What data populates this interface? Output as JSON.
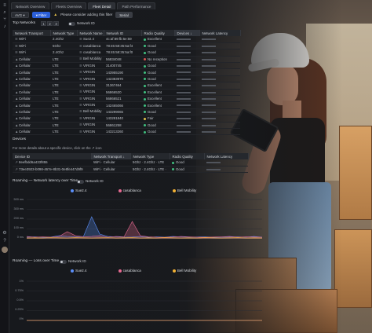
{
  "tabs": [
    {
      "label": "Network Overview",
      "active": false
    },
    {
      "label": "Fleets Overview",
      "active": false
    },
    {
      "label": "Fleet Detail",
      "active": true
    },
    {
      "label": "Path Performance",
      "active": false
    }
  ],
  "filterbar": {
    "avg_label": "AVG",
    "filter_label": "Filter",
    "warning_icon": "warning-triangle-icon",
    "warning_text": "Please consider adding this filter",
    "suggested_filter": "Serial"
  },
  "top_networks": {
    "title": "Top Networks",
    "pager": [
      "1",
      "2",
      "3"
    ],
    "toggle_label": "Network ID",
    "columns": [
      "Network Transport",
      "Network Type",
      "Network Name",
      "Network ID",
      "Radio Quality",
      "Devices",
      "Network Latency"
    ],
    "rows": [
      [
        "WiFi",
        "2.4Ghz",
        "Sue2.4",
        "4c:af:89:fb:5e:59",
        "Excellent",
        "",
        ""
      ],
      [
        "WiFi",
        "5Ghz",
        "casablanca",
        "78:45:58:35:5a:f4",
        "Good",
        "",
        ""
      ],
      [
        "WiFi",
        "2.4Ghz",
        "casablanca",
        "78:45:58:35:5a:f0",
        "Good",
        "",
        ""
      ],
      [
        "Cellular",
        "LTE",
        "Bell Mobility",
        "56834048",
        "No reception",
        "",
        ""
      ],
      [
        "Cellular",
        "LTE",
        "VIRGIN",
        "31400745",
        "Good",
        "",
        ""
      ],
      [
        "Cellular",
        "LTE",
        "VIRGIN",
        "143955190",
        "Good",
        "",
        ""
      ],
      [
        "Cellular",
        "LTE",
        "VIRGIN",
        "142383970",
        "Good",
        "",
        ""
      ],
      [
        "Cellular",
        "LTE",
        "VIRGIN",
        "31367464",
        "Excellent",
        "",
        ""
      ],
      [
        "Cellular",
        "LTE",
        "VIRGIN",
        "56866520",
        "Excellent",
        "",
        ""
      ],
      [
        "Cellular",
        "LTE",
        "VIRGIN",
        "56866521",
        "Excellent",
        "",
        ""
      ],
      [
        "Cellular",
        "LTE",
        "VIRGIN",
        "142465066",
        "Excellent",
        "",
        ""
      ],
      [
        "Cellular",
        "LTE",
        "Bell Mobility",
        "143299065",
        "Good",
        "",
        ""
      ],
      [
        "Cellular",
        "LTE",
        "VIRGIN",
        "143281840",
        "Fair",
        "",
        ""
      ],
      [
        "Cellular",
        "LTE",
        "VIRGIN",
        "56861258",
        "Good",
        "",
        ""
      ],
      [
        "Cellular",
        "LTE",
        "VIRGIN",
        "143213260",
        "Good",
        "",
        ""
      ]
    ]
  },
  "devices": {
    "title": "Devices",
    "note": "For more details about a specific device, click on the ↗ icon",
    "columns": [
      "Device ID",
      "Network Transport",
      "Network Type",
      "Radio Quality",
      "Network Latency"
    ],
    "rows": [
      [
        "8eefbdd6a433f855",
        "WiFi · Cellular",
        "5Ghz · 2.4Ghz · LTE",
        "Good",
        ""
      ],
      [
        "73ee3923-b098-467e-8b31-0e8fe447d9f9",
        "WiFi · Cellular",
        "5Ghz · 2.4Ghz · LTE ·",
        "Good",
        ""
      ]
    ]
  },
  "latency_panel": {
    "title": "Roaming — Network latency over Time",
    "toggle_label": "Network ID",
    "legend": [
      {
        "name": "Sue2.4",
        "color": "#5b8ff9"
      },
      {
        "name": "casablanca",
        "color": "#e86a92"
      },
      {
        "name": "Bell Mobility",
        "color": "#f2b134"
      }
    ],
    "yticks": [
      "500 ms",
      "300 ms",
      "200 ms",
      "100 ms",
      "0 ms"
    ]
  },
  "loss_panel": {
    "title": "Roaming — Loss over Time",
    "toggle_label": "Network ID",
    "legend": [
      {
        "name": "Sue2.4",
        "color": "#5b8ff9"
      },
      {
        "name": "casablanca",
        "color": "#e86a92"
      },
      {
        "name": "Bell Mobility",
        "color": "#f2b134"
      }
    ],
    "yticks": [
      "1%",
      "0.75%",
      "0.5%",
      "0.25%",
      "0%"
    ]
  },
  "chart_data": [
    {
      "type": "area",
      "title": "Roaming — Network latency over Time",
      "ylabel": "ms",
      "ylim": [
        0,
        500
      ],
      "series": [
        {
          "name": "Sue2.4",
          "values": [
            20,
            25,
            18,
            22,
            40,
            30,
            25,
            30,
            280,
            60,
            30,
            25,
            20,
            22,
            30,
            18,
            25,
            20,
            30,
            25,
            20,
            22,
            25,
            18,
            20,
            22,
            25,
            20,
            30,
            20
          ]
        },
        {
          "name": "casablanca",
          "values": [
            30,
            20,
            25,
            20,
            30,
            90,
            40,
            25,
            30,
            40,
            20,
            30,
            25,
            220,
            40,
            25,
            20,
            18,
            22,
            30,
            25,
            20,
            18,
            22,
            25,
            30,
            20,
            25,
            22,
            20
          ]
        },
        {
          "name": "Bell Mobility",
          "values": [
            10,
            12,
            10,
            15,
            12,
            10,
            14,
            12,
            10,
            12,
            15,
            10,
            12,
            14,
            10,
            12,
            10,
            14,
            12,
            10,
            12,
            10,
            14,
            12,
            10,
            12,
            14,
            10,
            12,
            10
          ]
        }
      ]
    },
    {
      "type": "line",
      "title": "Roaming — Loss over Time",
      "ylabel": "%",
      "ylim": [
        0,
        1
      ],
      "series": [
        {
          "name": "Sue2.4",
          "values": [
            0,
            0,
            0,
            0,
            0,
            0,
            0,
            0,
            0,
            0,
            0,
            0,
            0,
            0,
            0,
            0,
            0,
            0,
            0,
            0,
            0,
            0,
            0,
            0,
            0,
            0,
            0,
            0,
            0,
            0
          ]
        },
        {
          "name": "casablanca",
          "values": [
            0,
            0,
            0,
            0,
            0,
            0,
            0,
            0,
            0,
            0,
            0,
            0,
            0,
            0,
            0,
            0,
            0,
            0,
            0,
            0,
            0,
            0,
            0,
            0,
            0,
            0,
            0,
            0,
            0,
            0
          ]
        },
        {
          "name": "Bell Mobility",
          "values": [
            0,
            0,
            0,
            0,
            0,
            0,
            0,
            0,
            0,
            0,
            0,
            0,
            0,
            0,
            0,
            0,
            0,
            0,
            0,
            0,
            0,
            0,
            0,
            0,
            0,
            0,
            0,
            0,
            0,
            0
          ]
        }
      ]
    }
  ],
  "colors": {
    "accent": "#2b5fd9",
    "quality_excellent": "#3fbf7f",
    "quality_good": "#3fbf7f",
    "quality_fair": "#e2c04a",
    "quality_none": "#d9534f"
  }
}
